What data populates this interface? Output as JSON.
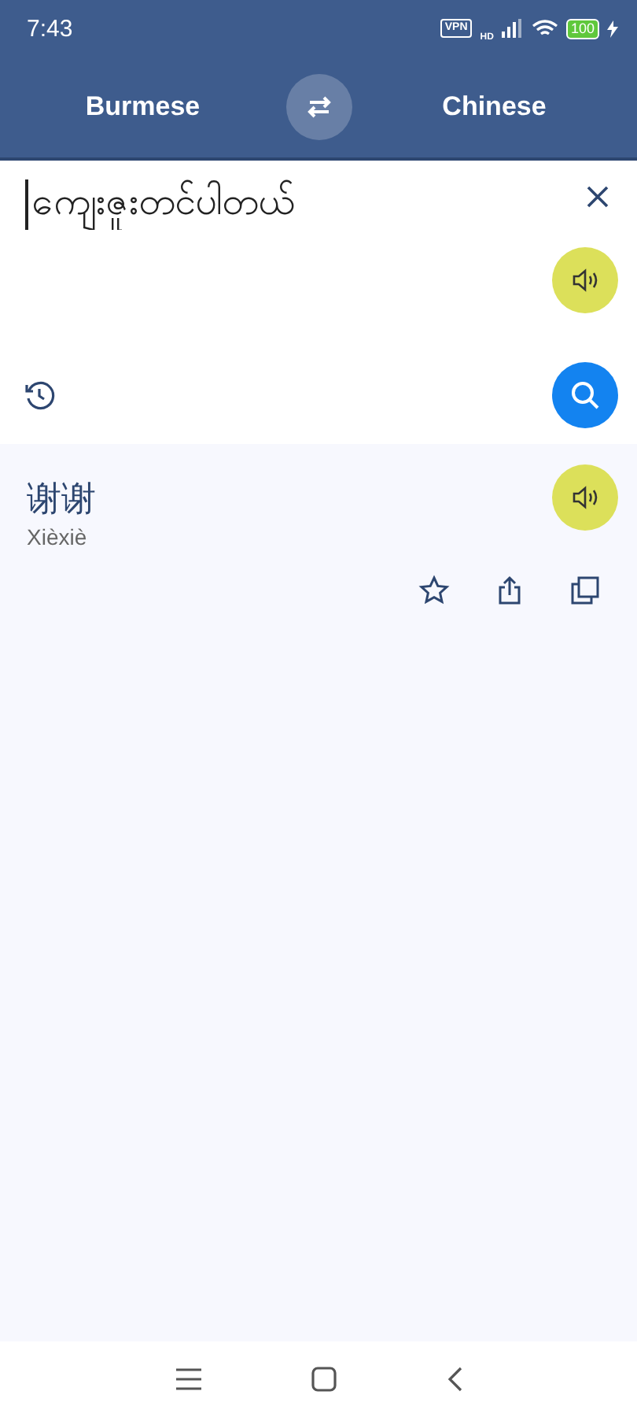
{
  "status_bar": {
    "time": "7:43",
    "vpn": "VPN",
    "network": "HD",
    "battery": "100"
  },
  "languages": {
    "source": "Burmese",
    "target": "Chinese"
  },
  "input": {
    "value": "ကျေးဇူးတင်ပါတယ်"
  },
  "result": {
    "text": "谢谢",
    "pinyin": "Xièxiè"
  }
}
